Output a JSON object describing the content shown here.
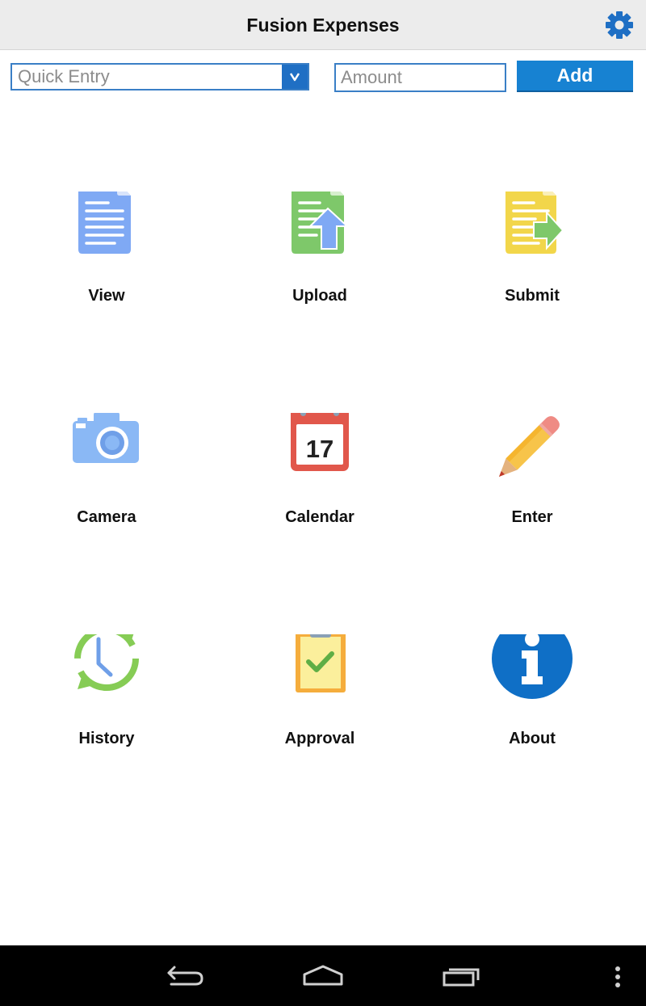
{
  "header": {
    "title": "Fusion Expenses",
    "settings_icon": "gear-icon",
    "accent": "#1f6fc4"
  },
  "quick_entry": {
    "placeholder": "Quick Entry",
    "dropdown_icon": "chevron-down-icon"
  },
  "amount": {
    "placeholder": "Amount"
  },
  "add_button": {
    "label": "Add",
    "color": "#1782d2"
  },
  "tiles": [
    {
      "label": "View",
      "icon": "document-icon"
    },
    {
      "label": "Upload",
      "icon": "upload-document-icon"
    },
    {
      "label": "Submit",
      "icon": "submit-document-icon"
    },
    {
      "label": "Camera",
      "icon": "camera-icon"
    },
    {
      "label": "Calendar",
      "icon": "calendar-icon",
      "day": "17"
    },
    {
      "label": "Enter",
      "icon": "pencil-icon"
    },
    {
      "label": "History",
      "icon": "history-icon"
    },
    {
      "label": "Approval",
      "icon": "clipboard-check-icon"
    },
    {
      "label": "About",
      "icon": "info-icon"
    }
  ],
  "navbar": {
    "icons": [
      "back-icon",
      "home-icon",
      "recent-apps-icon",
      "overflow-menu-icon"
    ]
  }
}
